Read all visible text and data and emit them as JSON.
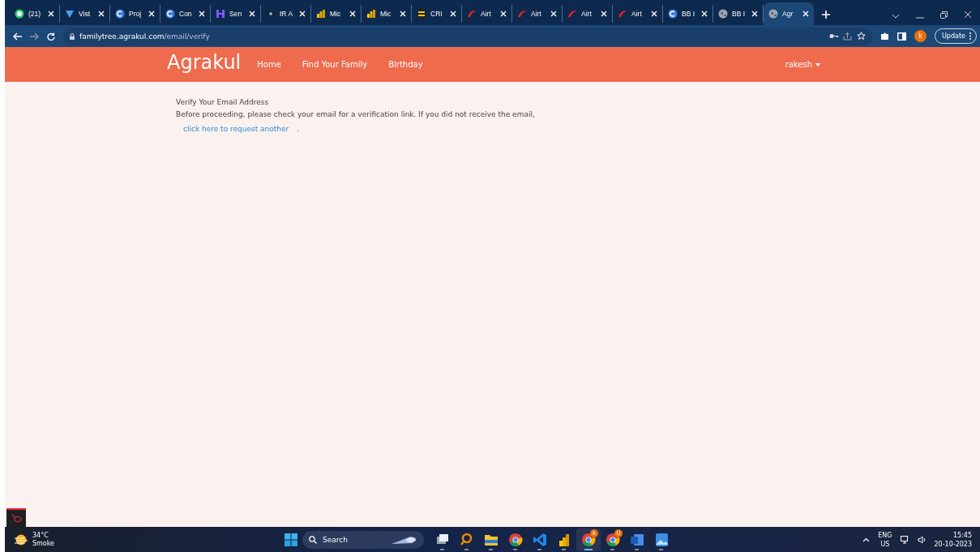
{
  "tabs": [
    {
      "title": "(21)",
      "kind": "whatsapp",
      "selected": false
    },
    {
      "title": "Vist",
      "kind": "vista",
      "selected": false
    },
    {
      "title": "Proj",
      "kind": "circle-c",
      "selected": false
    },
    {
      "title": "Con",
      "kind": "circle-c",
      "selected": false
    },
    {
      "title": "Sen",
      "kind": "h-mark",
      "selected": false
    },
    {
      "title": "IR A",
      "kind": "eye",
      "selected": false
    },
    {
      "title": "Mic",
      "kind": "bars",
      "selected": false
    },
    {
      "title": "Mic",
      "kind": "bars",
      "selected": false
    },
    {
      "title": "CRI",
      "kind": "square",
      "selected": false
    },
    {
      "title": "Airt",
      "kind": "swoosh",
      "selected": false
    },
    {
      "title": "Airt",
      "kind": "swoosh",
      "selected": false
    },
    {
      "title": "Airt",
      "kind": "swoosh",
      "selected": false
    },
    {
      "title": "Airt",
      "kind": "swoosh",
      "selected": false
    },
    {
      "title": "BB I",
      "kind": "circle-c",
      "selected": false
    },
    {
      "title": "BB I",
      "kind": "globe",
      "selected": false
    },
    {
      "title": "Agr",
      "kind": "globe",
      "selected": true
    }
  ],
  "address_bar": {
    "host": "familytree.agrakul.com",
    "path": "/email/verify"
  },
  "profile": {
    "initial": "k"
  },
  "update_button": {
    "label": "Update"
  },
  "site_nav": {
    "brand": "Agrakul",
    "links": [
      "Home",
      "Find Your Family",
      "Birthday"
    ],
    "user": "rakesh"
  },
  "content": {
    "heading": "Verify Your Email Address",
    "message": "Before proceeding, please check your email for a verification link. If you did not receive the email,",
    "link": "click here to request another",
    "end": "."
  },
  "taskbar": {
    "weather": {
      "temp": "34°C",
      "condition": "Smoke"
    },
    "search_placeholder": "Search",
    "apps": [
      {
        "kind": "taskview",
        "active": false
      },
      {
        "kind": "magnifier",
        "active": false
      },
      {
        "kind": "folder",
        "active": false
      },
      {
        "kind": "chrome",
        "active": false
      },
      {
        "kind": "vscode",
        "active": false
      },
      {
        "kind": "bars",
        "active": false
      },
      {
        "kind": "chrome",
        "active": true,
        "badge": "k"
      },
      {
        "kind": "chrome",
        "active": false,
        "badge": "U"
      },
      {
        "kind": "word",
        "active": false
      },
      {
        "kind": "photos",
        "active": false
      }
    ],
    "language": "ENG",
    "region": "US",
    "time": "15:45",
    "date": "20-10-2023"
  }
}
